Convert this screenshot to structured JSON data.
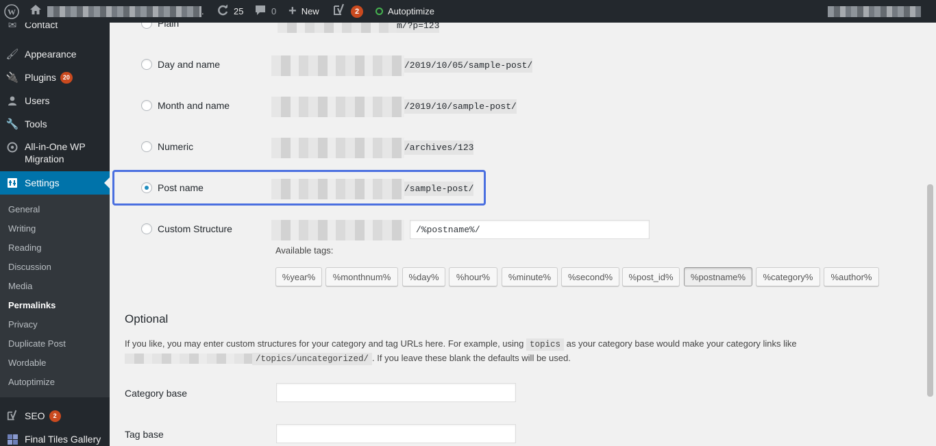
{
  "adminbar": {
    "wp_logo": "wordpress-icon",
    "site_name_suffix": ".",
    "updates_count": "25",
    "comments_count": "0",
    "new_label": "New",
    "yoast_badge": "2",
    "autoptimize_label": "Autoptimize"
  },
  "sidebar": {
    "items": [
      {
        "label": "Contact",
        "icon": "envelope-icon"
      },
      {
        "label": "Appearance",
        "icon": "paintbrush-icon"
      },
      {
        "label": "Plugins",
        "icon": "plug-icon",
        "badge": "20"
      },
      {
        "label": "Users",
        "icon": "user-icon"
      },
      {
        "label": "Tools",
        "icon": "wrench-icon"
      },
      {
        "label": "All-in-One WP",
        "label2": "Migration",
        "icon": "migration-icon"
      },
      {
        "label": "Settings",
        "icon": "settings-icon"
      },
      {
        "label": "SEO",
        "icon": "yoast-icon",
        "badge": "2"
      },
      {
        "label": "Final Tiles Gallery",
        "icon": "gallery-icon"
      }
    ],
    "submenu": [
      "General",
      "Writing",
      "Reading",
      "Discussion",
      "Media",
      "Permalinks",
      "Privacy",
      "Duplicate Post",
      "Wordable",
      "Autoptimize"
    ]
  },
  "permalinks": {
    "options": [
      {
        "label": "Plain",
        "url": "m/?p=123"
      },
      {
        "label": "Day and name",
        "url": "/2019/10/05/sample-post/"
      },
      {
        "label": "Month and name",
        "url": "/2019/10/sample-post/"
      },
      {
        "label": "Numeric",
        "url": "/archives/123"
      },
      {
        "label": "Post name",
        "url": "/sample-post/"
      },
      {
        "label": "Custom Structure",
        "value": "/%postname%/"
      }
    ],
    "available_tags_label": "Available tags:",
    "tags": [
      "%year%",
      "%monthnum%",
      "%day%",
      "%hour%",
      "%minute%",
      "%second%",
      "%post_id%",
      "%postname%",
      "%category%",
      "%author%"
    ]
  },
  "optional": {
    "heading": "Optional",
    "desc_part1": "If you like, you may enter custom structures for your category and tag URLs here. For example, using",
    "desc_code1": "topics",
    "desc_part2": "as your category base would make your category links like",
    "desc_code2": "/topics/uncategorized/",
    "desc_part3": ". If you leave these blank the defaults will be used.",
    "category_base_label": "Category base",
    "tag_base_label": "Tag base"
  }
}
